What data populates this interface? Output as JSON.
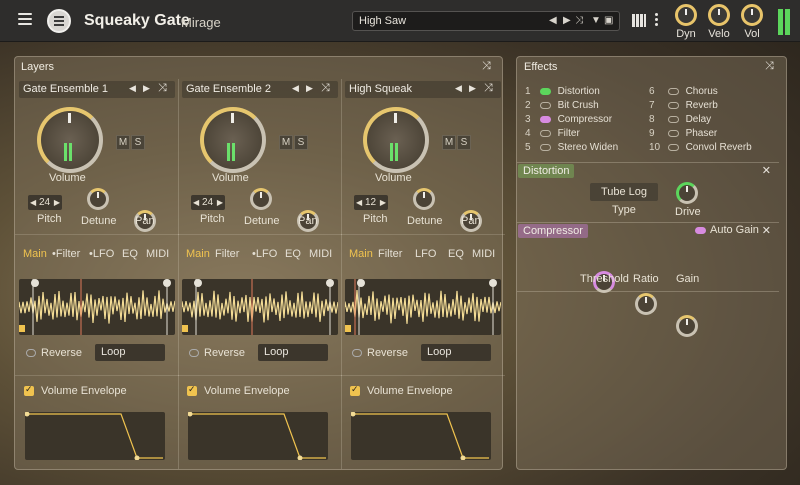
{
  "app": {
    "title": "Squeaky Gate",
    "subtitle": "Mirage"
  },
  "preset": {
    "name": "High Saw"
  },
  "top_knobs": [
    "Dyn",
    "Velo",
    "Vol"
  ],
  "layers_panel": {
    "title": "Layers"
  },
  "layers": [
    {
      "name": "Gate Ensemble 1",
      "volume_label": "Volume",
      "pitch_value": "24",
      "pitch_label": "Pitch",
      "detune_label": "Detune",
      "pan_label": "Pan",
      "m": "M",
      "s": "S",
      "tabs": [
        "Main",
        "•Filter",
        "•LFO",
        "EQ",
        "MIDI"
      ],
      "reverse": "Reverse",
      "loop": "Loop",
      "envelope": "Volume Envelope"
    },
    {
      "name": "Gate Ensemble 2",
      "volume_label": "Volume",
      "pitch_value": "24",
      "pitch_label": "Pitch",
      "detune_label": "Detune",
      "pan_label": "Pan",
      "m": "M",
      "s": "S",
      "tabs": [
        "Main",
        "Filter",
        "•LFO",
        "EQ",
        "MIDI"
      ],
      "reverse": "Reverse",
      "loop": "Loop",
      "envelope": "Volume Envelope"
    },
    {
      "name": "High Squeak",
      "volume_label": "Volume",
      "pitch_value": "12",
      "pitch_label": "Pitch",
      "detune_label": "Detune",
      "pan_label": "Pan",
      "m": "M",
      "s": "S",
      "tabs": [
        "Main",
        "Filter",
        "LFO",
        "EQ",
        "MIDI"
      ],
      "reverse": "Reverse",
      "loop": "Loop",
      "envelope": "Volume Envelope"
    }
  ],
  "effects_panel": {
    "title": "Effects"
  },
  "effects": [
    {
      "num": "1",
      "name": "Distortion",
      "state": "green"
    },
    {
      "num": "2",
      "name": "Bit Crush",
      "state": "off"
    },
    {
      "num": "3",
      "name": "Compressor",
      "state": "pink"
    },
    {
      "num": "4",
      "name": "Filter",
      "state": "off"
    },
    {
      "num": "5",
      "name": "Stereo Widen",
      "state": "off"
    },
    {
      "num": "6",
      "name": "Chorus",
      "state": "off"
    },
    {
      "num": "7",
      "name": "Reverb",
      "state": "off"
    },
    {
      "num": "8",
      "name": "Delay",
      "state": "off"
    },
    {
      "num": "9",
      "name": "Phaser",
      "state": "off"
    },
    {
      "num": "10",
      "name": "Convol Reverb",
      "state": "off"
    }
  ],
  "distortion": {
    "title": "Distortion",
    "type_value": "Tube Log",
    "type_label": "Type",
    "drive_label": "Drive"
  },
  "compressor": {
    "title": "Compressor",
    "auto_gain": "Auto Gain",
    "threshold": "Threshold",
    "ratio": "Ratio",
    "gain": "Gain"
  },
  "colors": {
    "accent": "#f0c34f",
    "meter": "#5cd65c",
    "pink": "#d78be0",
    "green": "#5cd65c"
  }
}
